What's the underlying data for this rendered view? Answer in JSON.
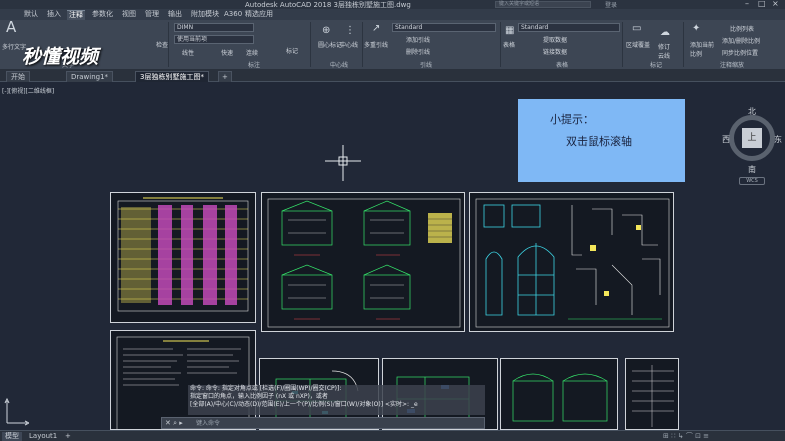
{
  "titlebar": {
    "title": "Autodesk AutoCAD 2018   3层独栋别墅施工图.dwg",
    "search_placeholder": "键入关键字或短语",
    "login": "登录"
  },
  "menu": {
    "tabs": [
      "默认",
      "插入",
      "注释",
      "参数化",
      "视图",
      "管理",
      "输出",
      "附加模块",
      "A360",
      "精选应用"
    ],
    "active_index": 2
  },
  "ribbon": {
    "text_panel": {
      "big_button": "多行文字",
      "check_label": "检查",
      "text_size": "150",
      "title": "文字"
    },
    "dim_panel": {
      "style": "DIMN",
      "use_current": "使用当前项",
      "linear": "线性",
      "quick": "快速",
      "continue": "连续",
      "mark": "标记",
      "title": "标注"
    },
    "centerline_panel": {
      "center_mark": "圆心标记",
      "centerline": "中心线",
      "title": "中心线"
    },
    "leader_panel": {
      "multileader": "多重引线",
      "style": "Standard",
      "add_leader": "添加引线",
      "remove_leader": "删除引线",
      "title": "引线"
    },
    "table_panel": {
      "table": "表格",
      "style": "Standard",
      "extract": "提取数据",
      "link": "链接数据",
      "title": "表格"
    },
    "markup_panel": {
      "area_cover": "区域覆盖",
      "revcloud": "修订云线",
      "title": "标记"
    },
    "scale_panel": {
      "add_current": "添加当前比例",
      "scale_list": "比例列表",
      "add_del_scale": "添加/删除比例",
      "sync_pos": "同步比例位置",
      "title": "注释缩放"
    }
  },
  "doctabs": {
    "tabs": [
      "开始",
      "Drawing1*",
      "3层独栋别墅施工图*"
    ],
    "active_index": 2
  },
  "canvas": {
    "view_label": "[-][俯视][二维线框]",
    "tip_title": "小提示：",
    "tip_body": "双击鼠标滚轴"
  },
  "viewcube": {
    "north": "北",
    "south": "南",
    "east": "东",
    "west": "西",
    "top": "上",
    "wcs": "WCS"
  },
  "command": {
    "history": [
      "命令: 命令: 指定对角点或 [栏选(F)/圈围(WP)/圈交(CP)]:",
      "指定窗口的角点，输入比例因子 (nX 或 nXP)，或者",
      "[全部(A)/中心(C)/动态(D)/范围(E)/上一个(P)/比例(S)/窗口(W)/对象(O)] <实时>:  _e"
    ],
    "placeholder": "键入命令"
  },
  "layout_tabs": [
    "模型",
    "Layout1"
  ],
  "layout_active_index": 0,
  "logo": "秒懂视频",
  "colors": {
    "canvas_bg": "#212837",
    "ribbon_bg": "#3d4654",
    "tip_bg": "#7fb8f5"
  }
}
